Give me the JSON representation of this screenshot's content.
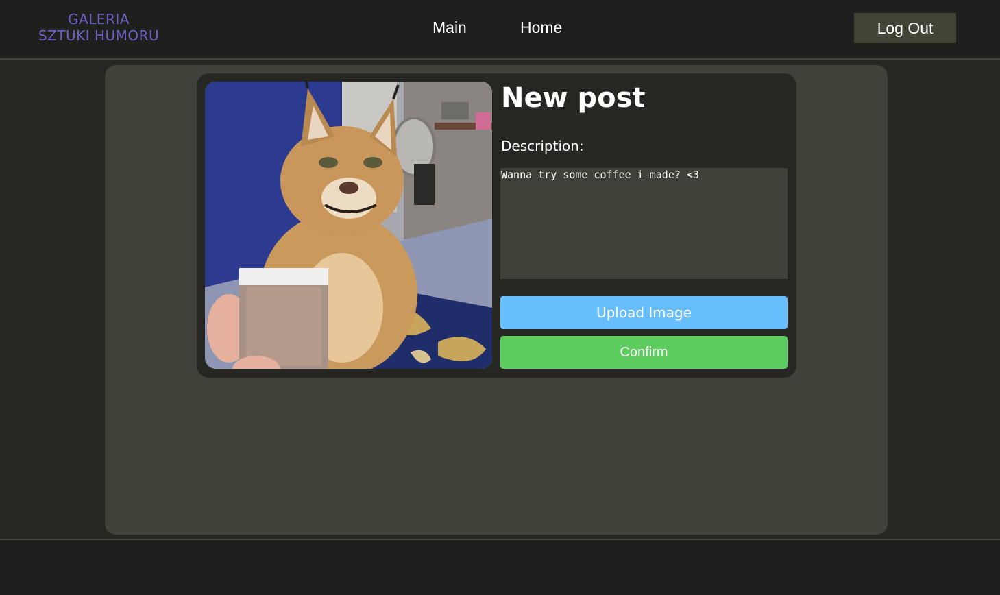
{
  "header": {
    "logo_line1": "GALERIA",
    "logo_line2": "SZTUKI HUMORU",
    "nav": [
      {
        "label": "Main"
      },
      {
        "label": "Home"
      }
    ],
    "logout_label": "Log Out"
  },
  "post_form": {
    "title": "New post",
    "description_label": "Description:",
    "description_value": "Wanna try some coffee i made? <3",
    "upload_label": "Upload Image",
    "confirm_label": "Confirm"
  },
  "colors": {
    "logo": "#6a62c4",
    "upload_button": "#67befd",
    "confirm_button": "#5bcc5d",
    "logout_button": "#434338",
    "panel": "#41413a"
  }
}
